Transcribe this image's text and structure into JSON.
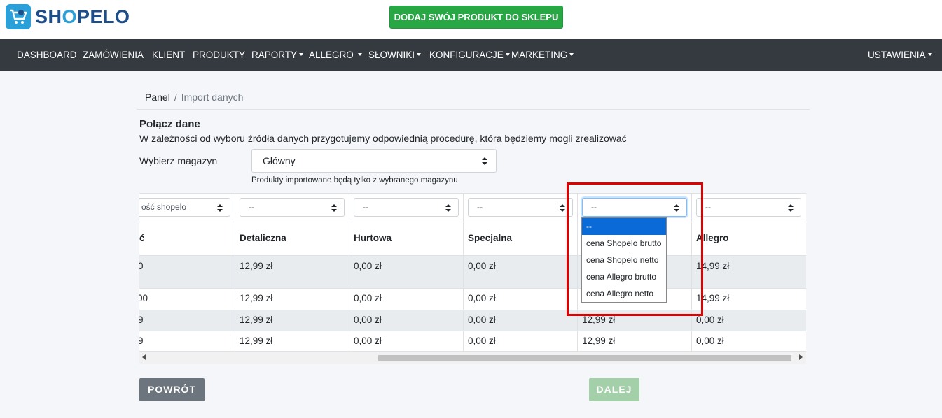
{
  "brand": {
    "name_prefix": "SH",
    "name_o": "O",
    "name_suffix": "PELO"
  },
  "header": {
    "add_product_label": "DODAJ SWÓJ PRODUKT DO SKLEPU"
  },
  "nav": {
    "items": [
      {
        "label": "DASHBOARD"
      },
      {
        "label": "ZAMÓWIENIA"
      },
      {
        "label": "KLIENT"
      },
      {
        "label": "PRODUKTY"
      },
      {
        "label": "RAPORTY"
      },
      {
        "label": "ALLEGRO"
      },
      {
        "label": "SŁOWNIKI"
      },
      {
        "label": "KONFIGURACJE"
      },
      {
        "label": "MARKETING"
      }
    ],
    "settings_label": "USTAWIENIA"
  },
  "breadcrumb": {
    "home": "Panel",
    "separator": "/",
    "current": "Import danych"
  },
  "section": {
    "title": "Połącz dane",
    "description": "W zależności od wyboru źródła danych przygotujemy odpowiednią procedurę, która będziemy mogli zrealizować"
  },
  "warehouse": {
    "label": "Wybierz magazyn",
    "selected": "Główny",
    "help": "Produkty importowane będą tylko z wybranego magazynu"
  },
  "table": {
    "selects": [
      "ość shopelo",
      "--",
      "--",
      "--",
      "--",
      "--"
    ],
    "headers": [
      "ć",
      "Detaliczna",
      "Hurtowa",
      "Specjalna",
      "",
      "Allegro"
    ],
    "rows": [
      [
        "0",
        "12,99 zł",
        "0,00 zł",
        "0,00 zł",
        "",
        "14,99 zł"
      ],
      [
        "00",
        "12,99 zł",
        "0,00 zł",
        "0,00 zł",
        "",
        "14,99 zł"
      ],
      [
        "9",
        "12,99 zł",
        "0,00 zł",
        "0,00 zł",
        "12,99 zł",
        "0,00 zł"
      ],
      [
        "9",
        "12,99 zł",
        "0,00 zł",
        "0,00 zł",
        "12,99 zł",
        "0,00 zł"
      ]
    ]
  },
  "dropdown": {
    "options": [
      "--",
      "cena Shopelo brutto",
      "cena Shopelo netto",
      "cena Allegro brutto",
      "cena Allegro netto"
    ],
    "selected_index": 0
  },
  "buttons": {
    "back": "POWRÓT",
    "next": "DALEJ"
  },
  "colors": {
    "brand_blue": "#1d4e89",
    "accent_green": "#28a745",
    "nav_bg": "#343a40",
    "highlight_red": "#e00000"
  }
}
